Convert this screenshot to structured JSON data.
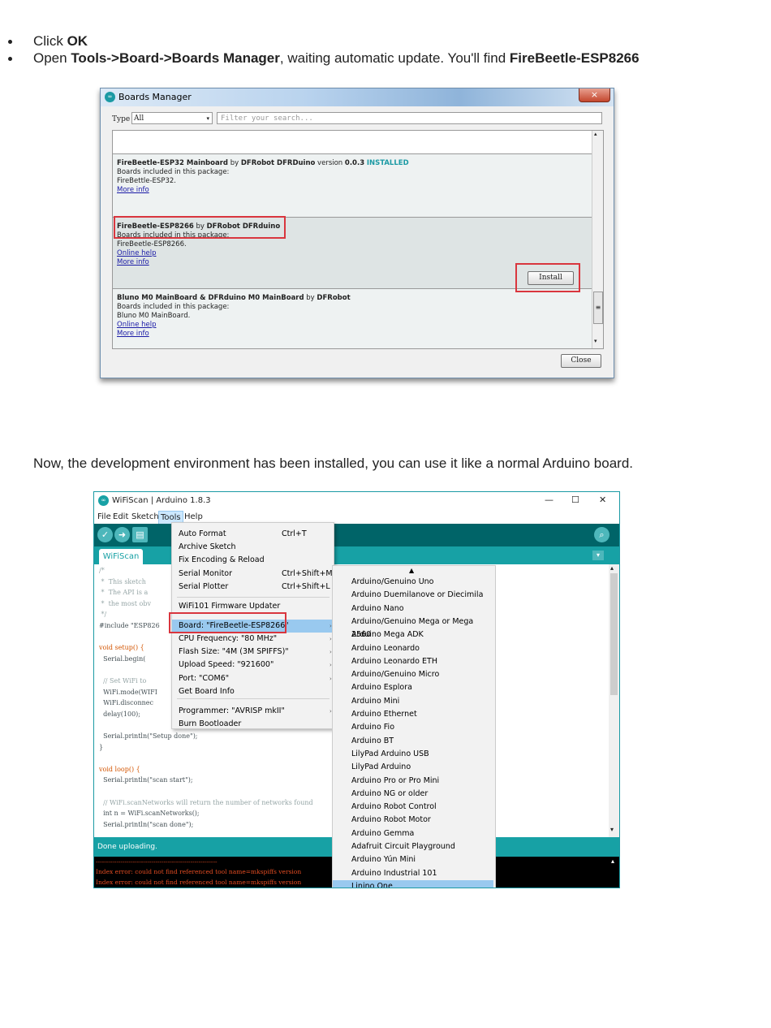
{
  "steps": {
    "step1": {
      "prefix": "Click ",
      "bold": "OK"
    },
    "step2": {
      "prefix": "Open ",
      "bold1": "Tools->Board->Boards Manager",
      "middle": ", waiting automatic update. You'll find ",
      "bold2": "FireBeetle-ESP8266"
    }
  },
  "paragraph": "Now, the development environment has been installed, you can use it like a normal Arduino board.",
  "boards_manager": {
    "title": "Boards Manager",
    "close_x": "×",
    "type_label": "Type",
    "type_value": "All",
    "type_arrow": "▾",
    "filter_placeholder": "Filter your search...",
    "packages": [
      {
        "name": "FireBeetle-ESP32 Mainboard",
        "by": " by ",
        "author": "DFRobot DFRDuino",
        "version_label": " version ",
        "version": "0.0.3",
        "status": "INSTALLED",
        "included": "Boards included in this package:",
        "boards": "FireBettle-ESP32.",
        "links": [
          "More info"
        ]
      },
      {
        "name": "FireBeetle-ESP8266",
        "by": " by ",
        "author": "DFRobot DFRduino",
        "included": "Boards included in this package:",
        "boards": "FireBeetle-ESP8266.",
        "links": [
          "Online help",
          "More info"
        ],
        "install_label": "Install"
      },
      {
        "name": "Bluno M0 MainBoard & DFRduino M0 MainBoard",
        "by": " by ",
        "author": "DFRobot",
        "included": "Boards included in this package:",
        "boards": "Bluno M0 MainBoard.",
        "links": [
          "Online help",
          "More info"
        ]
      }
    ],
    "close_label": "Close",
    "scroll_up": "▴",
    "scroll_down": "▾",
    "scroll_grip": "≡"
  },
  "ide": {
    "title": "WiFiScan | Arduino 1.8.3",
    "logo": "∞",
    "window_controls": {
      "minimize": "—",
      "maximize": "☐",
      "close": "✕"
    },
    "menus": [
      "File",
      "Edit",
      "Sketch",
      "Tools",
      "Help"
    ],
    "toolbar_icons": [
      "verify-icon",
      "upload-icon",
      "new-icon",
      "open-icon"
    ],
    "toolbar_glyphs": {
      "verify": "✓",
      "upload": "➜",
      "new": "▤",
      "serial": "⌕",
      "tab_menu": "▾"
    },
    "tab": "WiFiScan",
    "code_lines": [
      {
        "t": "/*",
        "c": "cm"
      },
      {
        "t": " *  This sketch",
        "c": "cm"
      },
      {
        "t": " *  The API is a",
        "c": "cm"
      },
      {
        "t": " *  the most obv",
        "c": "cm"
      },
      {
        "t": " */",
        "c": "cm"
      },
      {
        "t": "#include \"ESP826",
        "c": ""
      },
      {
        "t": "",
        "c": ""
      },
      {
        "t": "void setup() {",
        "c": "kw"
      },
      {
        "t": "  Serial.begin(",
        "c": ""
      },
      {
        "t": "",
        "c": ""
      },
      {
        "t": "  // Set WiFi to",
        "c": "cm"
      },
      {
        "t": "  WiFi.mode(WIFI",
        "c": ""
      },
      {
        "t": "  WiFi.disconnec",
        "c": ""
      },
      {
        "t": "  delay(100);",
        "c": ""
      },
      {
        "t": "",
        "c": ""
      },
      {
        "t": "  Serial.println(\"Setup done\");",
        "c": ""
      },
      {
        "t": "}",
        "c": ""
      },
      {
        "t": "",
        "c": ""
      },
      {
        "t": "void loop() {",
        "c": "kw"
      },
      {
        "t": "  Serial.println(\"scan start\");",
        "c": ""
      },
      {
        "t": "",
        "c": ""
      },
      {
        "t": "  // WiFi.scanNetworks will return the number of networks found",
        "c": "cm"
      },
      {
        "t": "  int n = WiFi.scanNetworks();",
        "c": ""
      },
      {
        "t": "  Serial.println(\"scan done\");",
        "c": ""
      }
    ],
    "status": "Done uploading.",
    "console": [
      "-----------------------------------------------------------",
      "Index error: could not find referenced tool name=mkspiffs version",
      "Index error: could not find referenced tool name=mkspiffs version"
    ],
    "scroll_glyphs": {
      "up": "▴",
      "down": "▾"
    },
    "tools_menu": [
      {
        "label": "Auto Format",
        "shortcut": "Ctrl+T"
      },
      {
        "label": "Archive Sketch",
        "shortcut": ""
      },
      {
        "label": "Fix Encoding & Reload",
        "shortcut": ""
      },
      {
        "label": "Serial Monitor",
        "shortcut": "Ctrl+Shift+M"
      },
      {
        "label": "Serial Plotter",
        "shortcut": "Ctrl+Shift+L"
      },
      {
        "label": "WiFi101 Firmware Updater",
        "shortcut": ""
      },
      {
        "label": "Board: \"FireBeetle-ESP8266\"",
        "shortcut": ""
      },
      {
        "label": "CPU Frequency: \"80 MHz\"",
        "shortcut": ""
      },
      {
        "label": "Flash Size: \"4M (3M SPIFFS)\"",
        "shortcut": ""
      },
      {
        "label": "Upload Speed: \"921600\"",
        "shortcut": ""
      },
      {
        "label": "Port: \"COM6\"",
        "shortcut": ""
      },
      {
        "label": "Get Board Info",
        "shortcut": ""
      },
      {
        "label": "Programmer: \"AVRISP mkII\"",
        "shortcut": ""
      },
      {
        "label": "Burn Bootloader",
        "shortcut": ""
      }
    ],
    "submenu_arrow": "›",
    "board_list_scroll_up": "▲",
    "board_list": [
      "Arduino/Genuino Uno",
      "Arduino Duemilanove or Diecimila",
      "Arduino Nano",
      "Arduino/Genuino Mega or Mega 2560",
      "Arduino Mega ADK",
      "Arduino Leonardo",
      "Arduino Leonardo ETH",
      "Arduino/Genuino Micro",
      "Arduino Esplora",
      "Arduino Mini",
      "Arduino Ethernet",
      "Arduino Fio",
      "Arduino BT",
      "LilyPad Arduino USB",
      "LilyPad Arduino",
      "Arduino Pro or Pro Mini",
      "Arduino NG or older",
      "Arduino Robot Control",
      "Arduino Robot Motor",
      "Arduino Gemma",
      "Adafruit Circuit Playground",
      "Arduino Yún Mini",
      "Arduino Industrial 101",
      "Linino One"
    ]
  },
  "colors": {
    "teal": "#17a1a5",
    "dark_teal": "#006468",
    "highlight_red": "#d9363e",
    "menu_highlight": "#99c9ef"
  }
}
